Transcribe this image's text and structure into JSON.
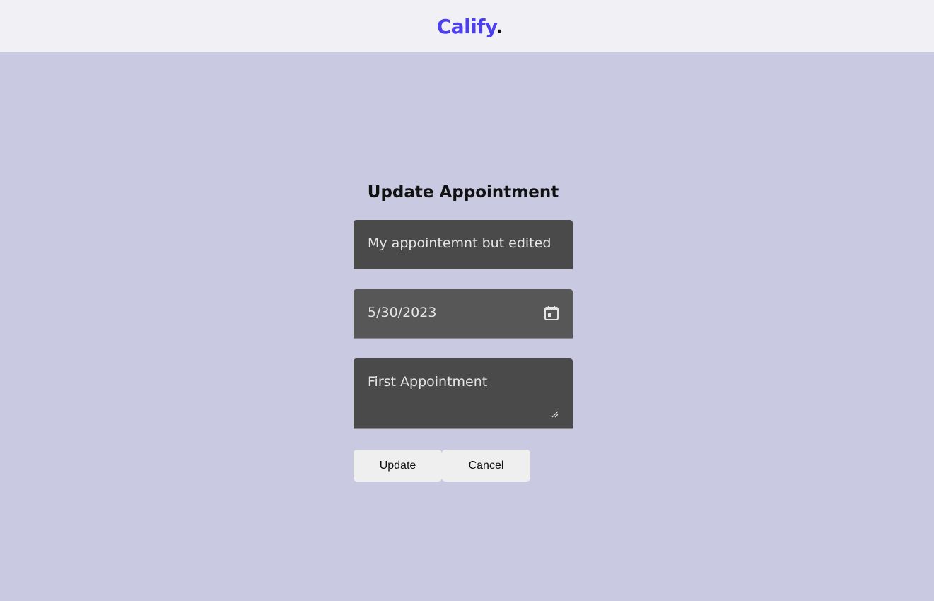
{
  "header": {
    "brand": "Calify",
    "brand_dot": ".",
    "brand_color": "#4b3ff0"
  },
  "form": {
    "title": "Update Appointment",
    "title_field": {
      "value": "My appointemnt but edited"
    },
    "date_field": {
      "value": "5/30/2023",
      "icon": "calendar-icon"
    },
    "description_field": {
      "value": "First Appointment"
    },
    "buttons": {
      "update_label": "Update",
      "cancel_label": "Cancel"
    }
  },
  "colors": {
    "background": "#c9cae1",
    "header_background": "#f0f0f5",
    "field_background": "#4a4a4a",
    "button_background": "#efefef"
  }
}
